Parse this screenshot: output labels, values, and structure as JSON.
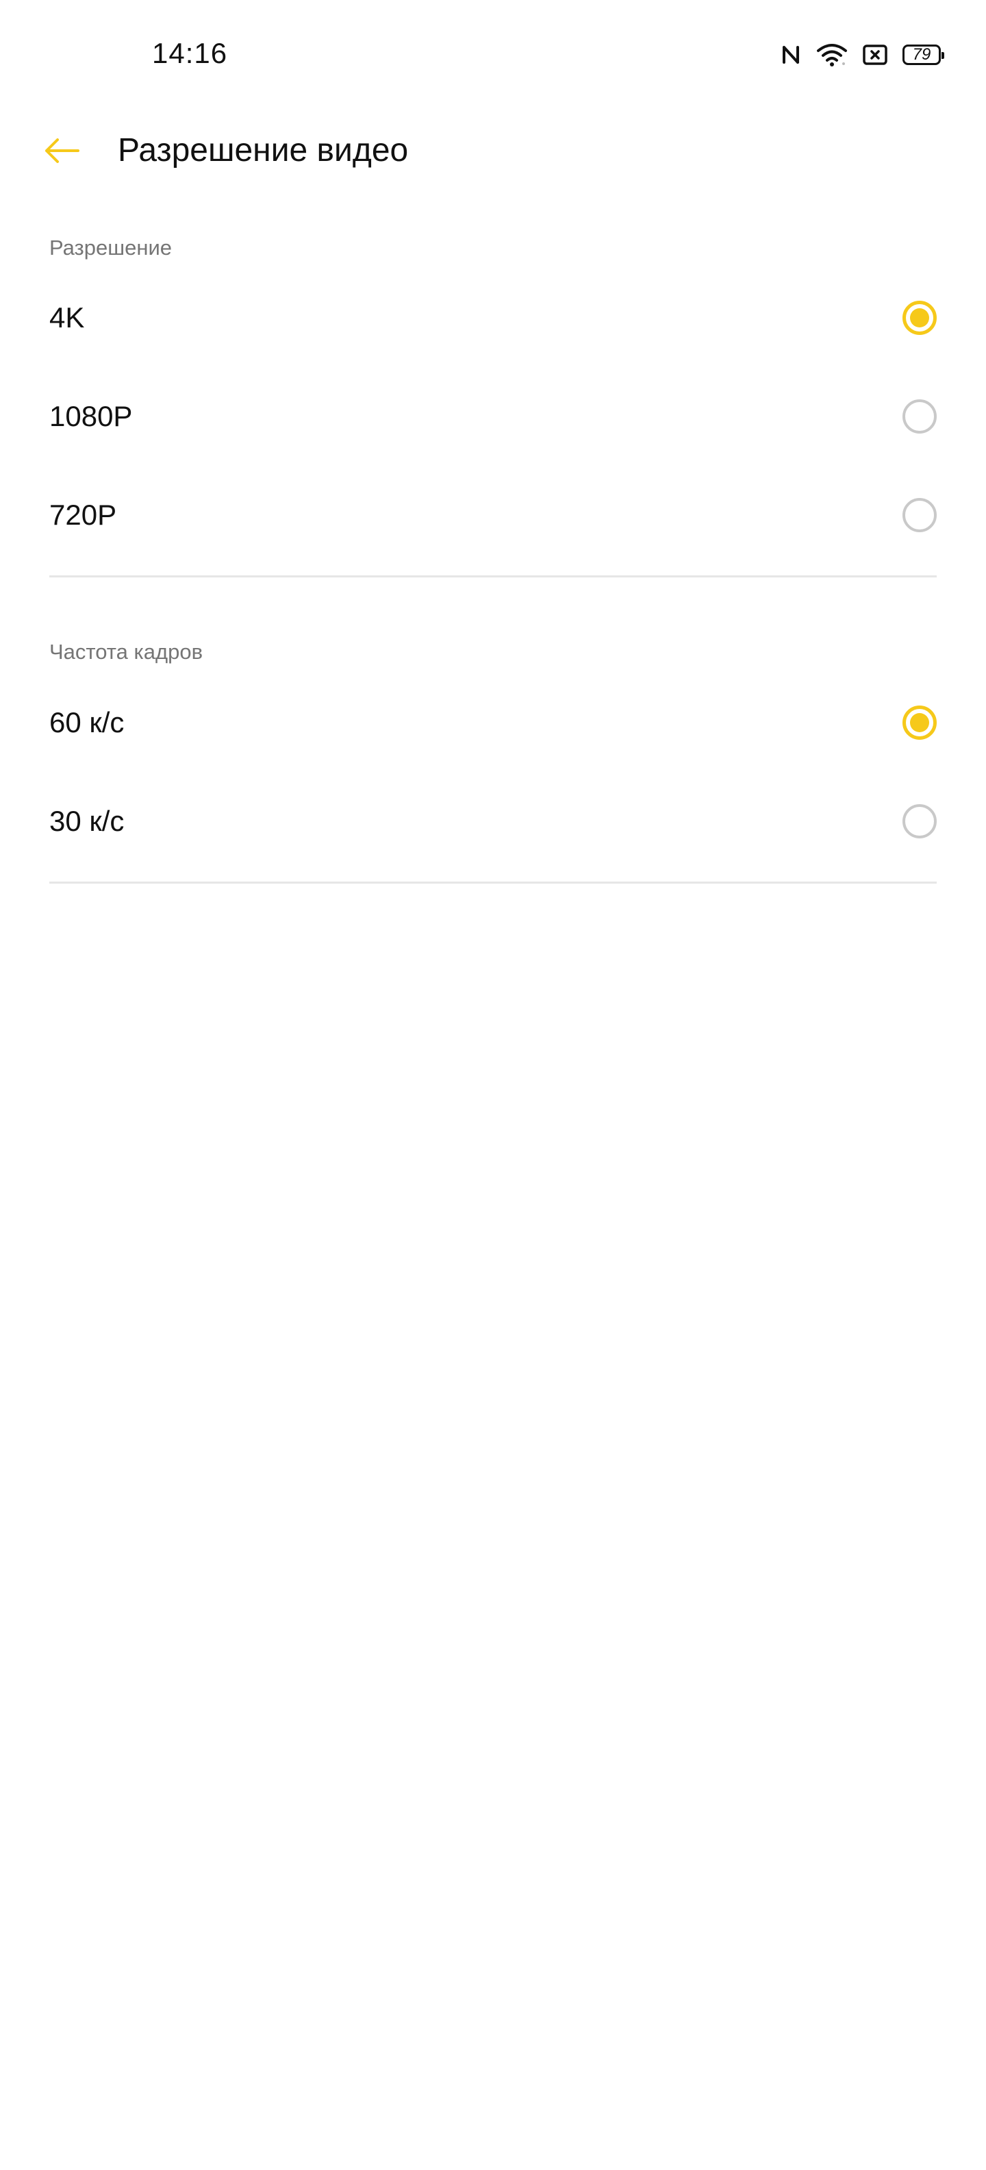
{
  "status_bar": {
    "time": "14:16",
    "icons": [
      "nfc-icon",
      "wifi-icon",
      "sim-disabled-icon",
      "battery-icon"
    ],
    "battery_level": "79"
  },
  "header": {
    "title": "Разрешение видео",
    "back_icon": "arrow-left-icon"
  },
  "colors": {
    "accent": "#f6c91a",
    "radio_unchecked": "#c9c9c9",
    "section_label": "#757575",
    "divider": "#e6e6e6"
  },
  "resolution": {
    "label": "Разрешение",
    "options": [
      {
        "label": "4K",
        "selected": true
      },
      {
        "label": "1080P",
        "selected": false
      },
      {
        "label": "720P",
        "selected": false
      }
    ]
  },
  "frame_rate": {
    "label": "Частота кадров",
    "options": [
      {
        "label": "60 к/с",
        "selected": true
      },
      {
        "label": "30 к/с",
        "selected": false
      }
    ]
  }
}
